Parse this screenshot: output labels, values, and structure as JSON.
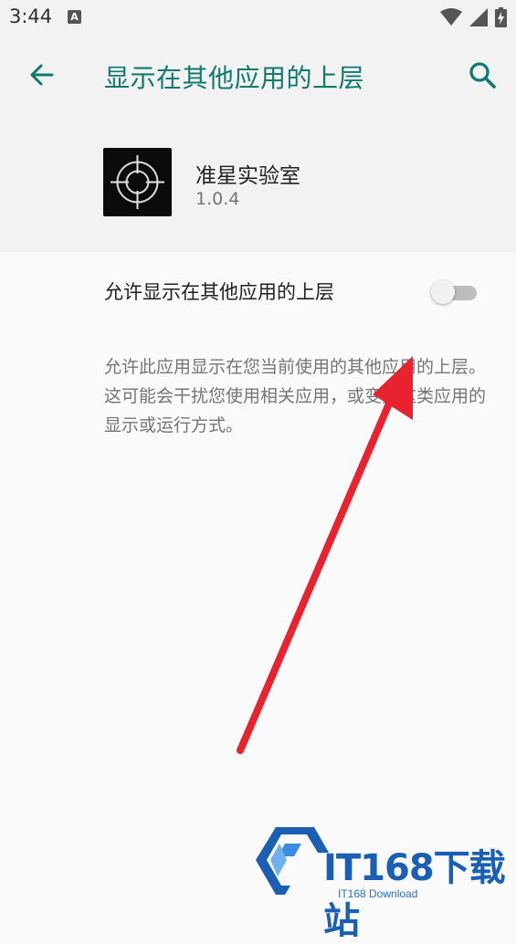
{
  "status_bar": {
    "time": "3:44",
    "notification_letter": "A"
  },
  "header": {
    "title": "显示在其他应用的上层",
    "back_icon": "arrow-left-icon",
    "search_icon": "search-icon",
    "accent_color": "#0f7a6c"
  },
  "app": {
    "name": "准星实验室",
    "version": "1.0.4",
    "icon": "crosshair-icon"
  },
  "setting": {
    "label": "允许显示在其他应用的上层",
    "enabled": false
  },
  "description": "允许此应用显示在您当前使用的其他应用的上层。这可能会干扰您使用相关应用，或变更这类应用的显示或运行方式。",
  "annotation": {
    "arrow_color": "#e8232f"
  },
  "watermark": {
    "brand": "IT168下载站",
    "subtitle": "IT168 Download",
    "color": "#1a5fb4"
  }
}
